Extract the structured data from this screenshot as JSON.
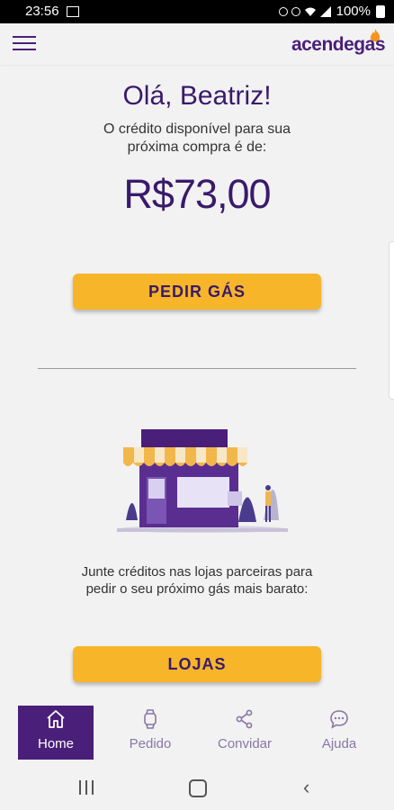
{
  "status_bar": {
    "time": "23:56",
    "battery": "100%"
  },
  "app": {
    "logo": "acendegas"
  },
  "main": {
    "greeting": "Olá, Beatriz!",
    "credit_text": "O crédito disponível para sua próxima compra é de:",
    "amount": "R$73,00",
    "order_gas_button": "PEDIR GÁS",
    "stores_text": "Junte créditos nas lojas parceiras para pedir o seu próximo gás mais barato:",
    "stores_button": "LOJAS"
  },
  "bottom_nav": {
    "items": [
      {
        "label": "Home",
        "icon": "home-icon",
        "active": true
      },
      {
        "label": "Pedido",
        "icon": "watch-icon",
        "active": false
      },
      {
        "label": "Convidar",
        "icon": "share-icon",
        "active": false
      },
      {
        "label": "Ajuda",
        "icon": "chat-icon",
        "active": false
      }
    ]
  },
  "colors": {
    "brand_purple": "#4a1f7a",
    "accent_yellow": "#f7b52a",
    "background": "#f2f2f2"
  }
}
